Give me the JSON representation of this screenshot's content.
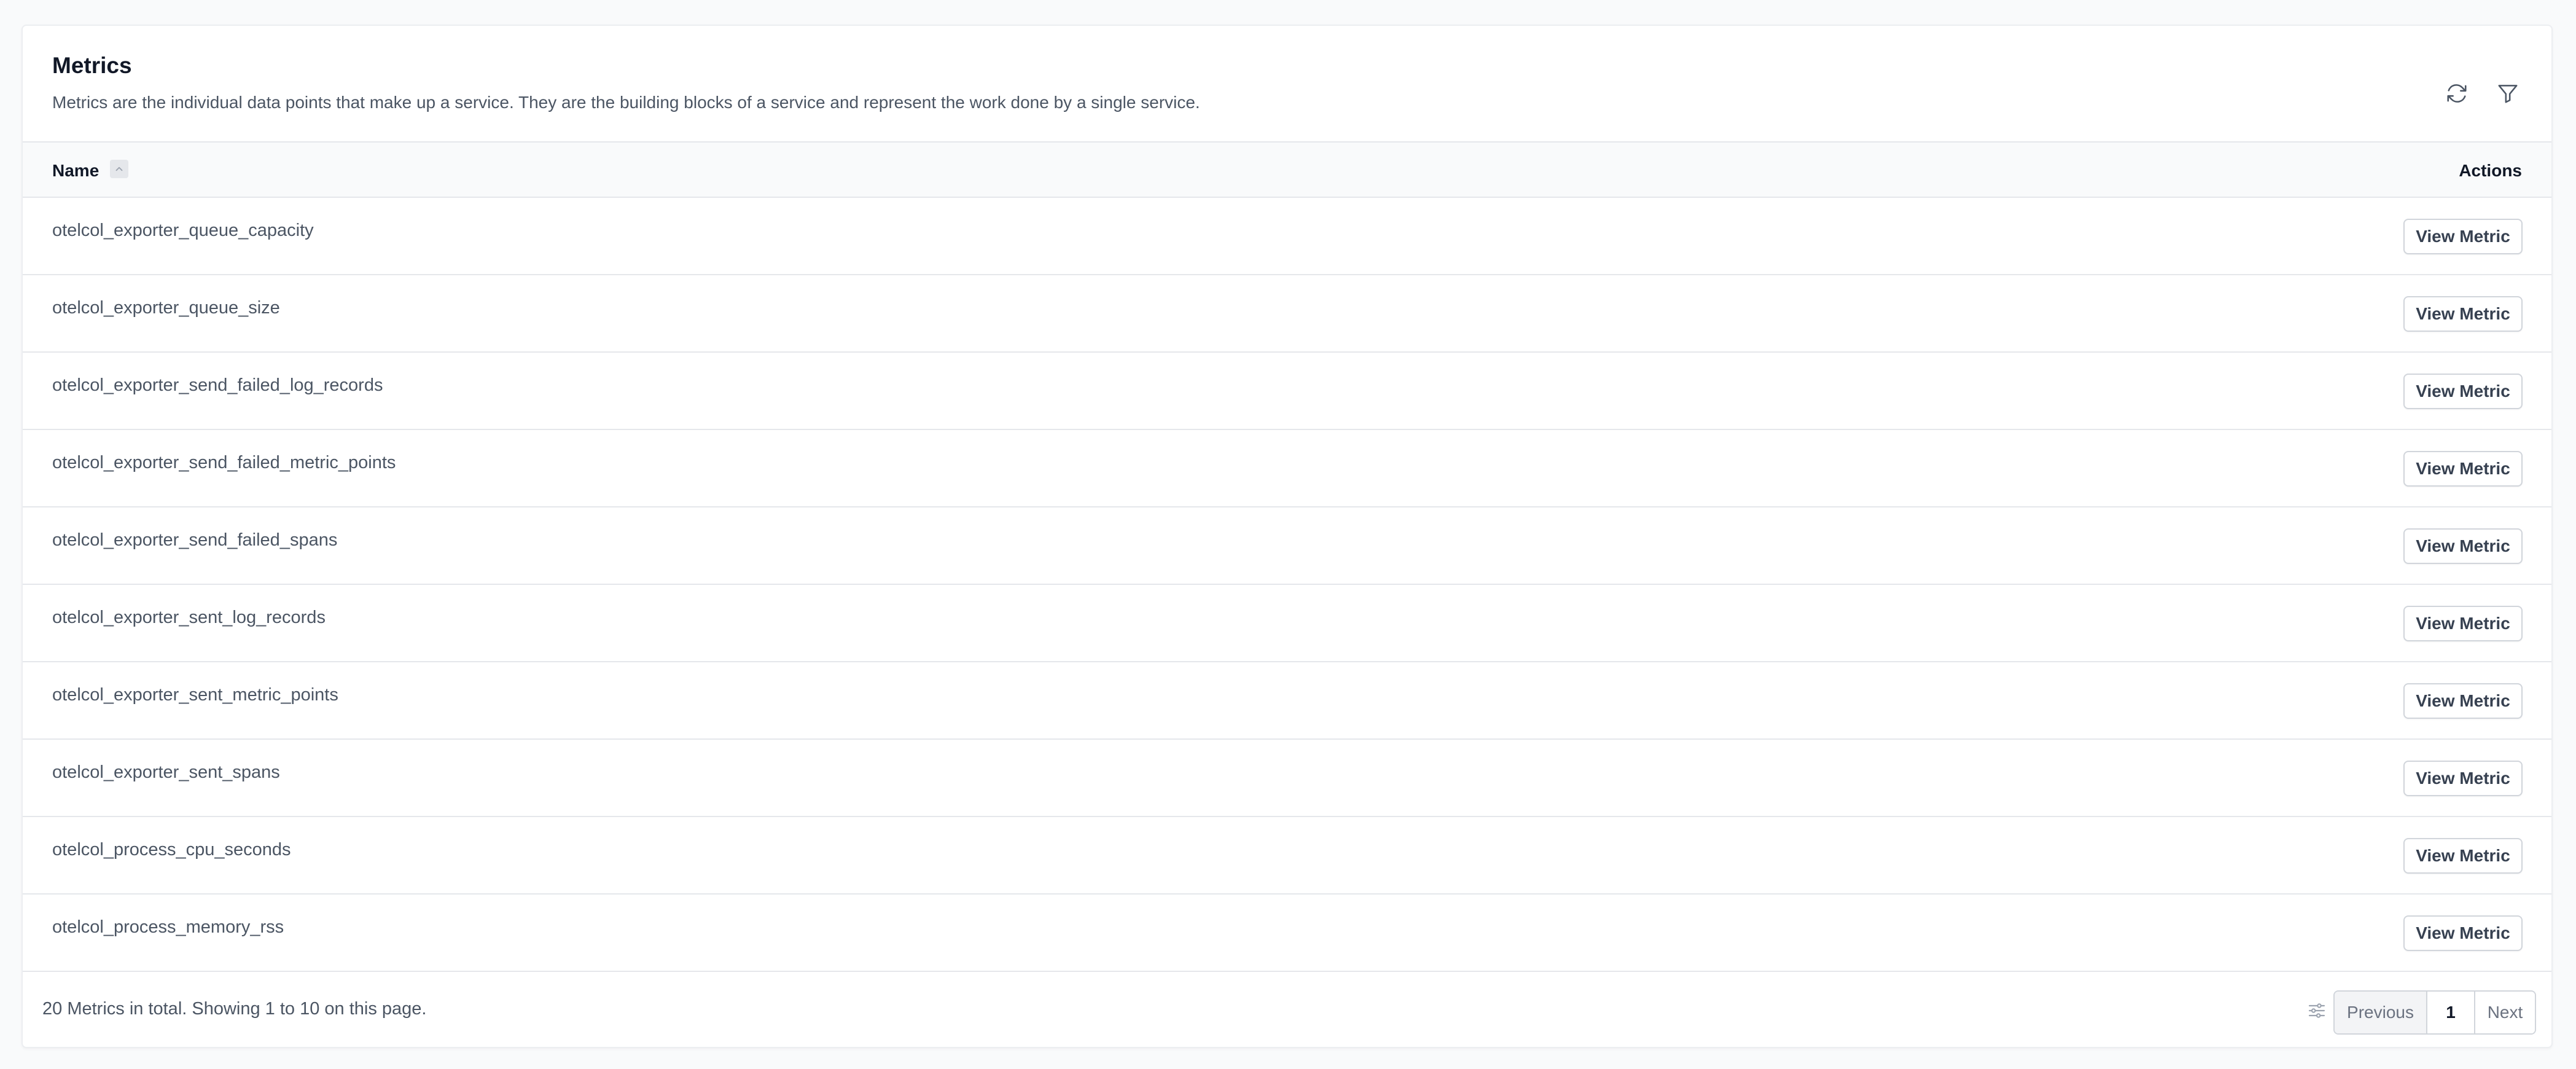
{
  "header": {
    "title": "Metrics",
    "description": "Metrics are the individual data points that make up a service. They are the building blocks of a service and represent the work done by a single service.",
    "refresh_icon": "refresh-icon",
    "filter_icon": "filter-icon"
  },
  "table": {
    "columns": {
      "name": "Name",
      "actions": "Actions"
    },
    "sort_icon": "chevron-up-icon",
    "rows": [
      {
        "name": "otelcol_exporter_queue_capacity",
        "action": "View Metric"
      },
      {
        "name": "otelcol_exporter_queue_size",
        "action": "View Metric"
      },
      {
        "name": "otelcol_exporter_send_failed_log_records",
        "action": "View Metric"
      },
      {
        "name": "otelcol_exporter_send_failed_metric_points",
        "action": "View Metric"
      },
      {
        "name": "otelcol_exporter_send_failed_spans",
        "action": "View Metric"
      },
      {
        "name": "otelcol_exporter_sent_log_records",
        "action": "View Metric"
      },
      {
        "name": "otelcol_exporter_sent_metric_points",
        "action": "View Metric"
      },
      {
        "name": "otelcol_exporter_sent_spans",
        "action": "View Metric"
      },
      {
        "name": "otelcol_process_cpu_seconds",
        "action": "View Metric"
      },
      {
        "name": "otelcol_process_memory_rss",
        "action": "View Metric"
      }
    ]
  },
  "footer": {
    "summary": "20 Metrics in total. Showing 1 to 10 on this page.",
    "settings_icon": "adjustments-icon",
    "pagination": {
      "previous": "Previous",
      "current_page": "1",
      "next": "Next"
    }
  }
}
